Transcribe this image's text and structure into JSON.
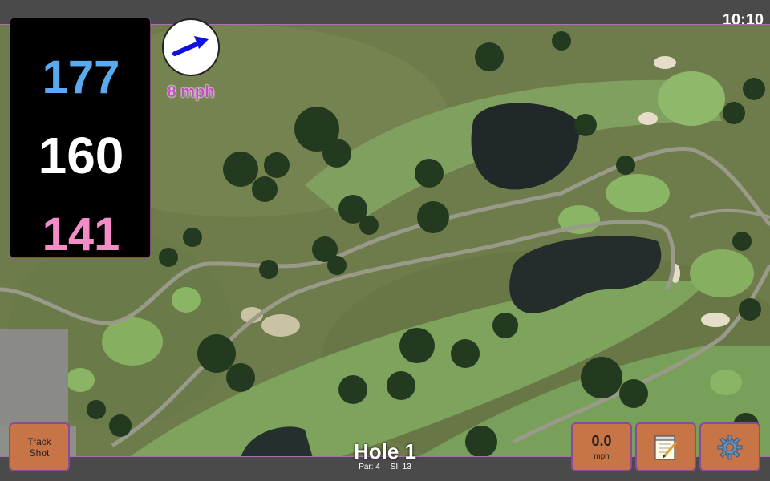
{
  "status": {
    "time": "10:10"
  },
  "distances": {
    "back": "177",
    "center": "160",
    "front": "141",
    "colors": {
      "back": "#5aaaf0",
      "center": "#ffffff",
      "front": "#f48cc8"
    }
  },
  "wind": {
    "speed_label": "8 mph",
    "direction_icon": "arrow-northeast-icon",
    "arrow_color": "#1010e0"
  },
  "buttons": {
    "track_shot": "Track\nShot",
    "wind_value": "0.0",
    "wind_unit": "mph",
    "notes_icon": "notepad-icon",
    "settings_icon": "gear-icon"
  },
  "hole": {
    "title": "Hole 1",
    "par": "Par: 4",
    "si": "SI: 13"
  },
  "colors": {
    "button_bg": "#c77547",
    "button_border": "#8a4a9a",
    "bar_bg": "#4a4a4a"
  }
}
